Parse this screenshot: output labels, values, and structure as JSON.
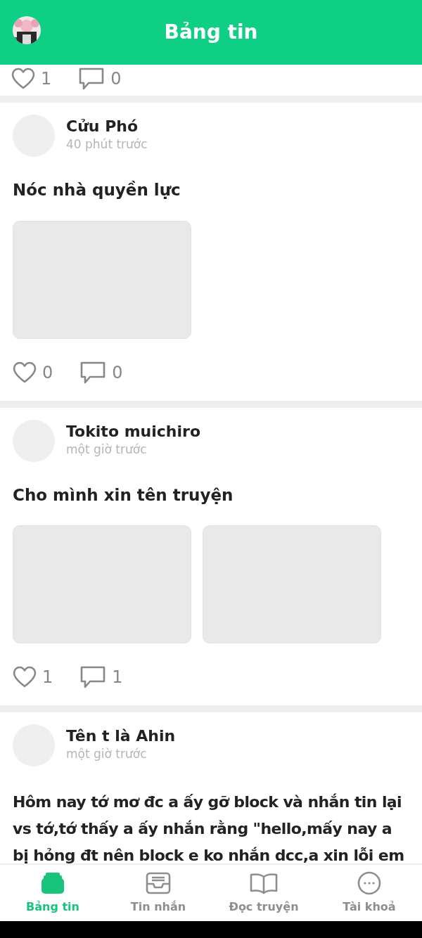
{
  "header": {
    "title": "Bảng tin"
  },
  "partial_post": {
    "likes": "1",
    "comments": "0"
  },
  "posts": [
    {
      "author": "Cửu Phó",
      "time": "40 phút trước",
      "title": "Nóc nhà quyền lực",
      "images": [
        {
          "kind": "placeholder"
        }
      ],
      "likes": "0",
      "comments": "0"
    },
    {
      "author": "Tokito muichiro",
      "time": "một giờ trước",
      "title": "Cho mình xin tên truyện",
      "images": [
        {
          "kind": "placeholder"
        },
        {
          "kind": "placeholder"
        }
      ],
      "likes": "1",
      "comments": "1"
    },
    {
      "author": "Tên t là Ahin",
      "time": "một giờ trước",
      "body_lines": [
        "Hôm nay tớ mơ đc a ấy gỡ block và nhắn tin lại",
        "vs tớ,tớ thấy a ấy nhắn rằng \"hello,mấy nay a",
        "bị hỏng đt nên block e ko nhắn dcc,a xin lỗi em"
      ]
    }
  ],
  "bottom_nav": [
    {
      "label": "Bảng tin",
      "kind": "feed",
      "selected": true
    },
    {
      "label": "Tin nhắn",
      "kind": "inbox",
      "selected": false
    },
    {
      "label": "Đọc truyện",
      "kind": "book",
      "selected": false
    },
    {
      "label": "Tài khoả",
      "kind": "more",
      "selected": false
    }
  ]
}
